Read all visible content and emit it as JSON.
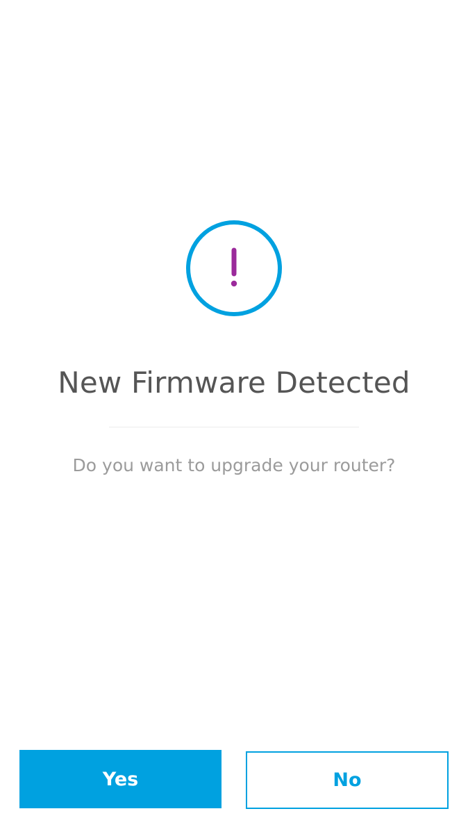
{
  "dialog": {
    "title": "New Firmware Detected",
    "message": "Do you want to upgrade your router?"
  },
  "icon": {
    "name": "exclamation-circle-icon",
    "ring_color": "#00a1e0",
    "mark_color": "#9b2a9b"
  },
  "buttons": {
    "yes_label": "Yes",
    "no_label": "No"
  },
  "colors": {
    "accent": "#00a1e0",
    "title_text": "#555555",
    "message_text": "#9b9b9b"
  }
}
